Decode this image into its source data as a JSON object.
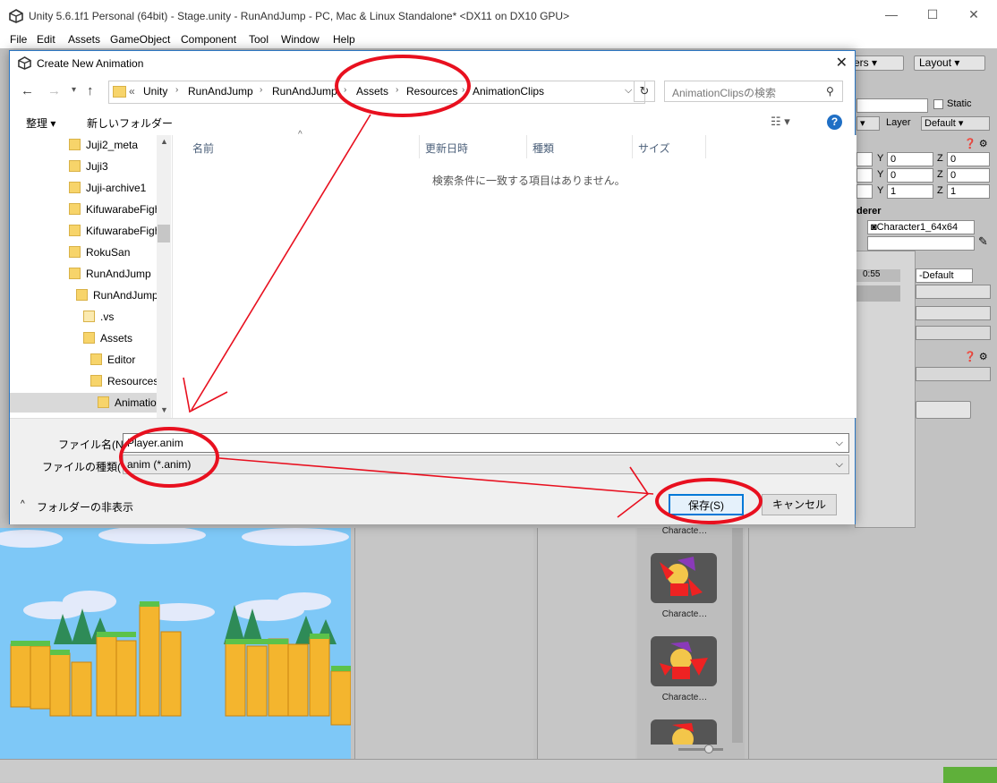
{
  "unity": {
    "title": "Unity 5.6.1f1 Personal (64bit) - Stage.unity - RunAndJump - PC, Mac & Linux Standalone* <DX11 on DX10 GPU>",
    "menu": [
      "File",
      "Edit",
      "Assets",
      "GameObject",
      "Component",
      "Tool",
      "Window",
      "Help"
    ],
    "layers_btn": "ers",
    "layout_btn": "Layout",
    "static_label": "Static",
    "layer_label": "Layer",
    "layer_value": "Default",
    "transform": [
      {
        "y_label": "Y",
        "y": "0",
        "z_label": "Z",
        "z": "0"
      },
      {
        "y_label": "Y",
        "y": "0",
        "z_label": "Z",
        "z": "0"
      },
      {
        "y_label": "Y",
        "y": "1",
        "z_label": "Z",
        "z": "1"
      }
    ],
    "renderer_label": "derer",
    "sprite_value": "Character1_64x64",
    "sorting_value": "-Default",
    "time_value": "0:55",
    "sprite_labels": [
      "Characte…",
      "Characte…",
      "Characte…"
    ]
  },
  "dialog": {
    "title": "Create New Animation",
    "breadcrumbs": [
      "«",
      "Unity",
      "RunAndJump",
      "RunAndJump",
      "Assets",
      "Resources",
      "AnimationClips"
    ],
    "search_placeholder": "AnimationClipsの検索",
    "organize": "整理",
    "new_folder": "新しいフォルダー",
    "help": "?",
    "tree": [
      {
        "label": "Juji2_meta",
        "indent": 0
      },
      {
        "label": "Juji3",
        "indent": 0
      },
      {
        "label": "Juji-archive1",
        "indent": 0
      },
      {
        "label": "KifuwarabeFigh",
        "indent": 0
      },
      {
        "label": "KifuwarabeFigh",
        "indent": 0
      },
      {
        "label": "RokuSan",
        "indent": 0
      },
      {
        "label": "RunAndJump",
        "indent": 0
      },
      {
        "label": "RunAndJump",
        "indent": 1
      },
      {
        "label": ".vs",
        "indent": 2
      },
      {
        "label": "Assets",
        "indent": 2
      },
      {
        "label": "Editor",
        "indent": 3
      },
      {
        "label": "Resources",
        "indent": 3
      },
      {
        "label": "Animatio",
        "indent": 4
      }
    ],
    "columns": [
      "名前",
      "更新日時",
      "種類",
      "サイズ"
    ],
    "empty_message": "検索条件に一致する項目はありません。",
    "filename_label": "ファイル名(N):",
    "filename_value": "Player.anim",
    "filetype_label": "ファイルの種類(T):",
    "filetype_value": "anim (*.anim)",
    "hide_folders": "フォルダーの非表示",
    "save_btn": "保存(S)",
    "cancel_btn": "キャンセル"
  },
  "colors": {
    "annotation": "#e8101f",
    "dialog_border": "#2b76c2",
    "sky": "#7ec8f7"
  }
}
